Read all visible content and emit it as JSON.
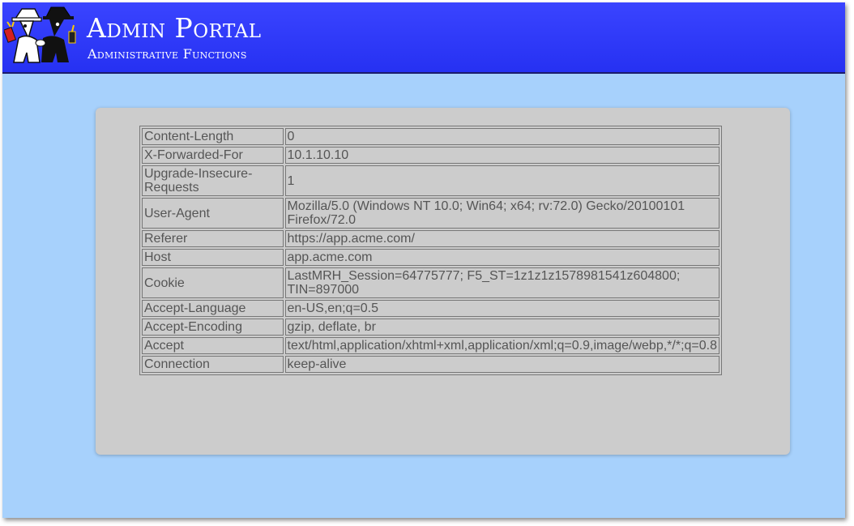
{
  "header": {
    "title": "Admin Portal",
    "subtitle": "Administrative Functions",
    "logo": "spy-vs-spy-logo"
  },
  "request_headers": [
    {
      "name": "Content-Length",
      "value": "0"
    },
    {
      "name": "X-Forwarded-For",
      "value": "10.1.10.10"
    },
    {
      "name": "Upgrade-Insecure-Requests",
      "value": "1"
    },
    {
      "name": "User-Agent",
      "value": "Mozilla/5.0 (Windows NT 10.0; Win64; x64; rv:72.0) Gecko/20100101 Firefox/72.0"
    },
    {
      "name": "Referer",
      "value": "https://app.acme.com/"
    },
    {
      "name": "Host",
      "value": "app.acme.com"
    },
    {
      "name": "Cookie",
      "value": "LastMRH_Session=64775777; F5_ST=1z1z1z1578981541z604800; TIN=897000"
    },
    {
      "name": "Accept-Language",
      "value": "en-US,en;q=0.5"
    },
    {
      "name": "Accept-Encoding",
      "value": "gzip, deflate, br"
    },
    {
      "name": "Accept",
      "value": "text/html,application/xhtml+xml,application/xml;q=0.9,image/webp,*/*;q=0.8"
    },
    {
      "name": "Connection",
      "value": "keep-alive"
    }
  ],
  "colors": {
    "page_background": "#a7d1fc",
    "header_background": "#2b35f8",
    "panel_background": "#cccccc",
    "text": "#555555"
  }
}
